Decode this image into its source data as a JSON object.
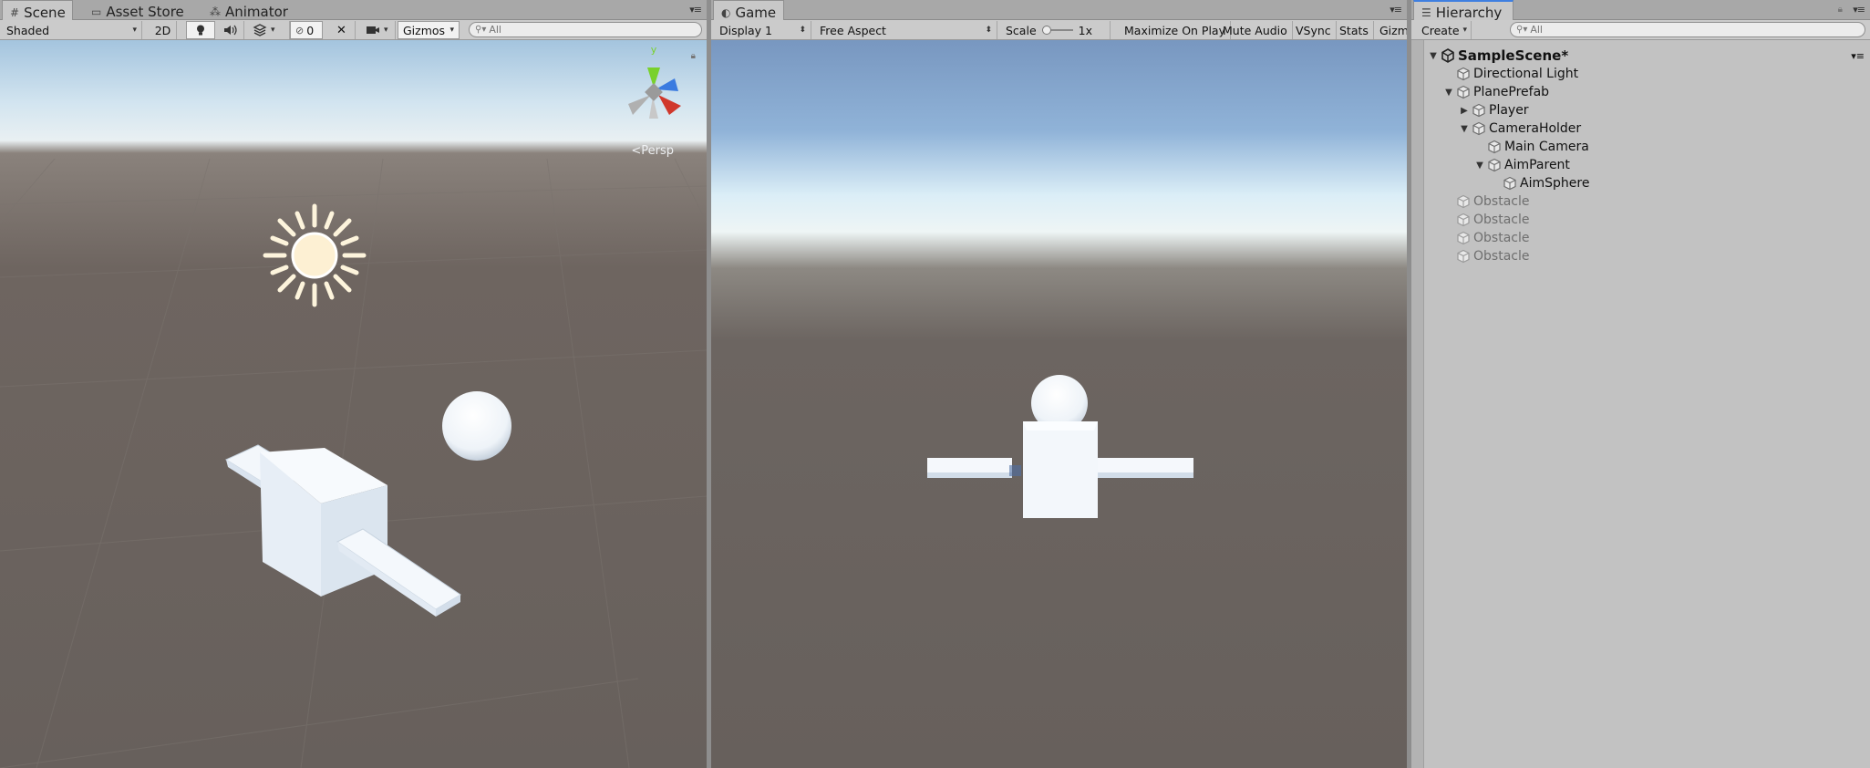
{
  "scene_panel": {
    "tabs": [
      {
        "label": "Scene",
        "icon": "grid-icon"
      },
      {
        "label": "Asset Store",
        "icon": "store-icon"
      },
      {
        "label": "Animator",
        "icon": "animator-icon"
      }
    ],
    "toolbar": {
      "draw_mode": "Shaded",
      "mode_2d": "2D",
      "hidden_count": "0",
      "gizmos": "Gizmos",
      "search_placeholder": "All"
    },
    "view": {
      "projection_label": "Persp",
      "axis_y": "y"
    }
  },
  "game_panel": {
    "tab": {
      "label": "Game",
      "icon": "game-icon"
    },
    "toolbar": {
      "display": "Display 1",
      "aspect": "Free Aspect",
      "scale_label": "Scale",
      "scale_value": "1x",
      "maximize": "Maximize On Play",
      "mute": "Mute Audio",
      "vsync": "VSync",
      "stats": "Stats",
      "gizmos": "Gizm"
    }
  },
  "hierarchy_panel": {
    "tab": {
      "label": "Hierarchy",
      "icon": "list-icon"
    },
    "toolbar": {
      "create": "Create",
      "search_placeholder": "All"
    },
    "items": [
      {
        "label": "SampleScene*",
        "depth": 0,
        "foldout": "open",
        "kind": "scene"
      },
      {
        "label": "Directional Light",
        "depth": 1,
        "foldout": "none",
        "kind": "object"
      },
      {
        "label": "PlanePrefab",
        "depth": 1,
        "foldout": "open",
        "kind": "object"
      },
      {
        "label": "Player",
        "depth": 2,
        "foldout": "closed",
        "kind": "object"
      },
      {
        "label": "CameraHolder",
        "depth": 2,
        "foldout": "open",
        "kind": "object"
      },
      {
        "label": "Main Camera",
        "depth": 3,
        "foldout": "none",
        "kind": "object"
      },
      {
        "label": "AimParent",
        "depth": 3,
        "foldout": "open",
        "kind": "object"
      },
      {
        "label": "AimSphere",
        "depth": 4,
        "foldout": "none",
        "kind": "object"
      },
      {
        "label": "Obstacle",
        "depth": 1,
        "foldout": "none",
        "kind": "inactive"
      },
      {
        "label": "Obstacle",
        "depth": 1,
        "foldout": "none",
        "kind": "inactive"
      },
      {
        "label": "Obstacle",
        "depth": 1,
        "foldout": "none",
        "kind": "inactive"
      },
      {
        "label": "Obstacle",
        "depth": 1,
        "foldout": "none",
        "kind": "inactive"
      }
    ]
  },
  "colors": {
    "tab_accent": "#3f7fe0",
    "panel_bg": "#c2c2c2",
    "ground": "#67605c",
    "sky": "#a4c4de"
  }
}
